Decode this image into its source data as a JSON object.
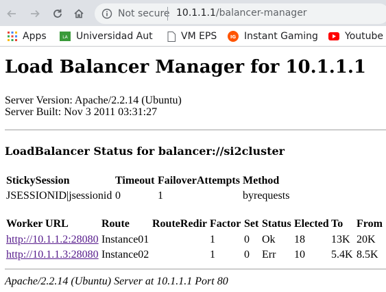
{
  "browser": {
    "security_label": "Not secure",
    "url_host": "10.1.1.1",
    "url_path": "/balancer-manager"
  },
  "bookmarks": [
    {
      "label": "Apps",
      "icon": "apps-grid-icon"
    },
    {
      "label": "Universidad Aut",
      "icon": "university-icon"
    },
    {
      "label": "VM EPS",
      "icon": "document-icon"
    },
    {
      "label": "Instant Gaming",
      "icon": "instant-gaming-icon"
    },
    {
      "label": "Youtube",
      "icon": "youtube-icon"
    }
  ],
  "page": {
    "title": "Load Balancer Manager for 10.1.1.1",
    "server_version": "Server Version: Apache/2.2.14 (Ubuntu)",
    "server_built": "Server Built: Nov 3 2011 03:31:27",
    "balancer_heading": "LoadBalancer Status for balancer://si2cluster",
    "balancer_table": {
      "headers": [
        "StickySession",
        "Timeout",
        "FailoverAttempts",
        "Method"
      ],
      "row": [
        "JSESSIONID|jsessionid",
        "0",
        "1",
        "byrequests"
      ]
    },
    "worker_table": {
      "headers": [
        "Worker URL",
        "Route",
        "RouteRedir",
        "Factor",
        "Set",
        "Status",
        "Elected",
        "To",
        "From"
      ],
      "rows": [
        {
          "url": "http://10.1.1.2:28080",
          "route": "Instance01",
          "route_redir": "",
          "factor": "1",
          "set": "0",
          "status": "Ok",
          "elected": "18",
          "to": "13K",
          "from": "20K"
        },
        {
          "url": "http://10.1.1.3:28080",
          "route": "Instance02",
          "route_redir": "",
          "factor": "1",
          "set": "0",
          "status": "Err",
          "elected": "10",
          "to": "5.4K",
          "from": "8.5K"
        }
      ]
    },
    "footer": "Apache/2.2.14 (Ubuntu) Server at 10.1.1.1 Port 80"
  },
  "colors": {
    "toolbar_bg": "#dee1e6",
    "visited_link": "#551a8b",
    "youtube_red": "#ff0000",
    "instant_gaming_orange": "#ff5400",
    "university_green": "#3a9b3a"
  }
}
